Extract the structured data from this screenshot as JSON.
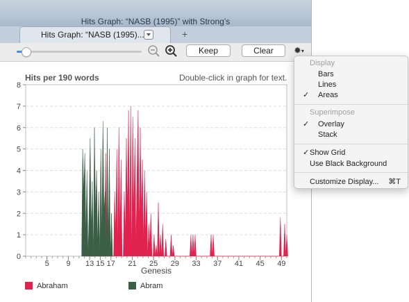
{
  "window": {
    "title": "Hits Graph: “NASB (1995)” with Strong’s"
  },
  "tab": {
    "label": "Hits Graph: “NASB (1995)...",
    "menu_icon": "tab-menu-icon"
  },
  "toolbar": {
    "zoom_slider_level": 0.07,
    "keep_label": "Keep",
    "clear_label": "Clear",
    "icons": [
      "zoom-out-icon",
      "zoom-in-icon",
      "gear-icon"
    ]
  },
  "graph": {
    "header": "Hits per 190 words",
    "hint": "Double-click in graph for text."
  },
  "chart_data": {
    "type": "area",
    "xlabel": "Genesis",
    "ylabel": "",
    "xlim": [
      1,
      50
    ],
    "ylim": [
      0,
      8
    ],
    "x_ticks": [
      "5",
      "9",
      "13",
      "15",
      "17",
      "21",
      "25",
      "29",
      "33",
      "37",
      "41",
      "45",
      "49"
    ],
    "x_tick_values": [
      5,
      9,
      13,
      15,
      17,
      21,
      25,
      29,
      33,
      37,
      41,
      45,
      49
    ],
    "y_ticks": [
      "0",
      "1",
      "2",
      "3",
      "4",
      "5",
      "6",
      "7",
      "8"
    ],
    "grid": true,
    "legend": "bottom",
    "series": [
      {
        "name": "Abraham",
        "color": "#e0224f",
        "x": [
          11.8,
          12.0,
          12.2,
          12.4,
          12.6,
          14.0,
          14.2,
          14.4,
          15.8,
          16.0,
          16.2,
          17.5,
          17.7,
          17.9,
          18.1,
          18.3,
          18.5,
          18.7,
          18.9,
          19.1,
          19.3,
          19.5,
          19.7,
          19.9,
          20.1,
          20.3,
          20.5,
          20.7,
          20.9,
          21.1,
          21.3,
          21.5,
          21.7,
          21.9,
          22.1,
          22.3,
          22.5,
          22.7,
          22.9,
          23.1,
          23.3,
          23.5,
          23.7,
          23.9,
          24.1,
          24.3,
          24.5,
          24.7,
          24.9,
          25.1,
          25.3,
          25.5,
          25.7,
          25.9,
          26.1,
          26.3,
          26.5,
          26.7,
          26.9,
          27.1,
          27.3,
          27.5,
          27.7,
          27.9,
          28.1,
          28.3,
          28.5,
          28.7,
          28.9,
          31.8,
          32.0,
          32.2,
          32.4,
          32.6,
          32.8,
          33.0,
          35.6,
          35.8,
          36.0,
          36.2,
          36.4,
          48.6,
          48.8,
          49.0,
          49.4,
          49.6,
          49.8,
          50.0,
          50.2
        ],
        "y": [
          0,
          3.5,
          0,
          1,
          0,
          0,
          2.5,
          0,
          0,
          4.8,
          0,
          0,
          3,
          1,
          5,
          0.5,
          6,
          1,
          4.5,
          0,
          0,
          3,
          1,
          5.5,
          2,
          6.8,
          1,
          7,
          0,
          6.5,
          2,
          5.5,
          0.5,
          4,
          6.8,
          1,
          6,
          2,
          4.5,
          0.5,
          4,
          1,
          3,
          0,
          1.5,
          0.5,
          2,
          0,
          0,
          1,
          0,
          0.5,
          0,
          2.5,
          0,
          1,
          0,
          1.5,
          0,
          0,
          0.8,
          0,
          0,
          0,
          0,
          1,
          0,
          0.5,
          0,
          0,
          1,
          0,
          1,
          0,
          1,
          0,
          0,
          1,
          0,
          1,
          0,
          0,
          1.8,
          0,
          0,
          1.5,
          0,
          1,
          0
        ],
        "values": [
          0,
          3.5,
          0,
          1,
          0,
          0,
          2.5,
          0,
          0,
          4.8,
          0,
          0,
          3,
          1,
          5,
          0.5,
          6,
          1,
          4.5,
          0,
          0,
          3,
          1,
          5.5,
          2,
          6.8,
          1,
          7,
          0,
          6.5,
          2,
          5.5,
          0.5,
          4,
          6.8,
          1,
          6,
          2,
          4.5,
          0.5,
          4,
          1,
          3,
          0,
          1.5,
          0.5,
          2,
          0,
          0,
          1,
          0,
          0.5,
          0,
          2.5,
          0,
          1,
          0,
          1.5,
          0,
          0,
          0.8,
          0,
          0,
          0,
          0,
          1,
          0,
          0.5,
          0,
          0,
          1,
          0,
          1,
          0,
          1,
          0,
          0,
          1,
          0,
          1,
          0,
          0,
          1.8,
          0,
          0,
          1.5,
          0,
          1,
          0
        ]
      },
      {
        "name": "Abram",
        "color": "#3b5f45",
        "x": [
          11.5,
          11.7,
          11.9,
          12.1,
          12.3,
          12.5,
          12.7,
          12.9,
          13.1,
          13.3,
          13.5,
          13.7,
          13.9,
          14.1,
          14.3,
          14.5,
          14.7,
          14.9,
          15.1,
          15.3,
          15.5,
          15.7,
          15.9,
          16.1,
          16.3,
          16.5,
          16.7,
          16.9,
          17.1,
          17.3
        ],
        "y": [
          0,
          5,
          3,
          4.8,
          1,
          4,
          0,
          2,
          5.5,
          1,
          3.5,
          0,
          6,
          2,
          4,
          0.5,
          3,
          0,
          5,
          1,
          6.3,
          2,
          3,
          0,
          6,
          0.5,
          5,
          0,
          2,
          0
        ],
        "values": [
          0,
          5,
          3,
          4.8,
          1,
          4,
          0,
          2,
          5.5,
          1,
          3.5,
          0,
          6,
          2,
          4,
          0.5,
          3,
          0,
          5,
          1,
          6.3,
          2,
          3,
          0,
          6,
          0.5,
          5,
          0,
          2,
          0
        ]
      }
    ]
  },
  "legend": {
    "items": [
      {
        "label": "Abraham",
        "color": "#e0224f"
      },
      {
        "label": "Abram",
        "color": "#3b5f45"
      }
    ]
  },
  "display_menu": {
    "display_header": "Display",
    "bars": "Bars",
    "lines": "Lines",
    "areas": "Areas",
    "areas_checked": true,
    "superimpose_header": "Superimpose",
    "overlay": "Overlay",
    "overlay_checked": true,
    "stack": "Stack",
    "show_grid": "Show Grid",
    "show_grid_checked": true,
    "black_background": "Use Black Background",
    "customize": "Customize Display...",
    "customize_shortcut": "⌘T",
    "checkmark": "✓"
  }
}
